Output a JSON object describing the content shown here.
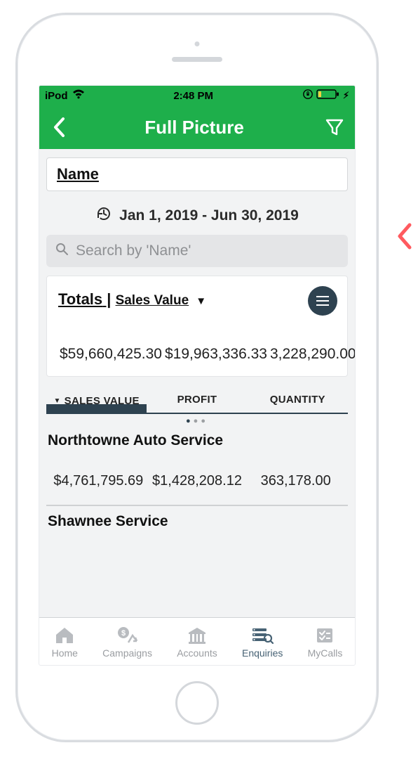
{
  "status": {
    "device": "iPod",
    "time": "2:48 PM"
  },
  "header": {
    "title": "Full Picture"
  },
  "filter": {
    "byLabel": "Name",
    "dateRange": "Jan 1, 2019 - Jun 30, 2019",
    "searchPlaceholder": "Search by 'Name'"
  },
  "totals": {
    "label": "Totals",
    "sortLabel": "Sales Value",
    "salesValue": "$59,660,425.30",
    "profit": "$19,963,336.33",
    "quantity": "3,228,290.00"
  },
  "columns": {
    "salesValue": "SALES VALUE",
    "profit": "PROFIT",
    "quantity": "QUANTITY"
  },
  "rows": [
    {
      "name": "Northtowne Auto Service",
      "salesValue": "$4,761,795.69",
      "profit": "$1,428,208.12",
      "quantity": "363,178.00"
    },
    {
      "name": "Shawnee Service",
      "salesValue": "",
      "profit": "",
      "quantity": ""
    }
  ],
  "tabbar": {
    "home": "Home",
    "campaigns": "Campaigns",
    "accounts": "Accounts",
    "enquiries": "Enquiries",
    "mycalls": "MyCalls"
  }
}
